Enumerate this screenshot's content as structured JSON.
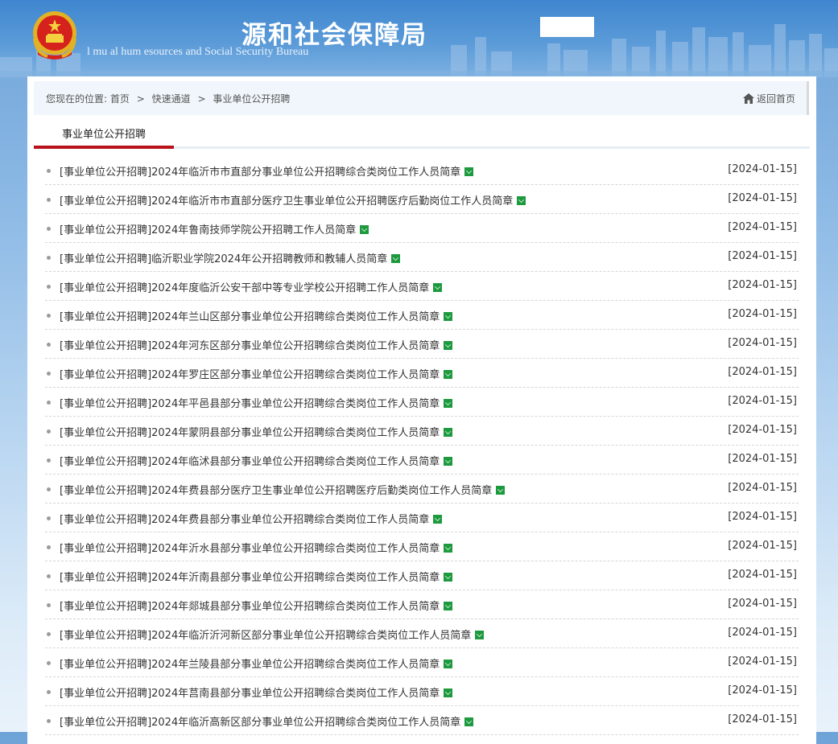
{
  "header": {
    "title_cn": "源和社会保障局",
    "title_en": "l    mu    al hum    esources and Social Security Bureau",
    "emblem_icon": "national-emblem-icon"
  },
  "breadcrumb": {
    "prefix": "您现在的位置:",
    "items": [
      "首页",
      "快速通道",
      "事业单位公开招聘"
    ],
    "separator": ">"
  },
  "home_link": {
    "label": "返回首页",
    "icon": "home-icon"
  },
  "tab": {
    "label": "事业单位公开招聘"
  },
  "colors": {
    "accent_red": "#b9121b",
    "new_badge": "#1d9a3e",
    "banner_blue": "#3f86cf"
  },
  "articles": [
    {
      "title": "[事业单位公开招聘]2024年临沂市市直部分事业单位公开招聘综合类岗位工作人员简章",
      "date": "[2024-01-15]"
    },
    {
      "title": "[事业单位公开招聘]2024年临沂市市直部分医疗卫生事业单位公开招聘医疗后勤岗位工作人员简章",
      "date": "[2024-01-15]"
    },
    {
      "title": "[事业单位公开招聘]2024年鲁南技师学院公开招聘工作人员简章",
      "date": "[2024-01-15]"
    },
    {
      "title": "[事业单位公开招聘]临沂职业学院2024年公开招聘教师和教辅人员简章",
      "date": "[2024-01-15]"
    },
    {
      "title": "[事业单位公开招聘]2024年度临沂公安干部中等专业学校公开招聘工作人员简章",
      "date": "[2024-01-15]"
    },
    {
      "title": "[事业单位公开招聘]2024年兰山区部分事业单位公开招聘综合类岗位工作人员简章",
      "date": "[2024-01-15]"
    },
    {
      "title": "[事业单位公开招聘]2024年河东区部分事业单位公开招聘综合类岗位工作人员简章",
      "date": "[2024-01-15]"
    },
    {
      "title": "[事业单位公开招聘]2024年罗庄区部分事业单位公开招聘综合类岗位工作人员简章",
      "date": "[2024-01-15]"
    },
    {
      "title": "[事业单位公开招聘]2024年平邑县部分事业单位公开招聘综合类岗位工作人员简章",
      "date": "[2024-01-15]"
    },
    {
      "title": "[事业单位公开招聘]2024年蒙阴县部分事业单位公开招聘综合类岗位工作人员简章",
      "date": "[2024-01-15]"
    },
    {
      "title": "[事业单位公开招聘]2024年临沭县部分事业单位公开招聘综合类岗位工作人员简章",
      "date": "[2024-01-15]"
    },
    {
      "title": "[事业单位公开招聘]2024年费县部分医疗卫生事业单位公开招聘医疗后勤类岗位工作人员简章",
      "date": "[2024-01-15]"
    },
    {
      "title": "[事业单位公开招聘]2024年费县部分事业单位公开招聘综合类岗位工作人员简章",
      "date": "[2024-01-15]"
    },
    {
      "title": "[事业单位公开招聘]2024年沂水县部分事业单位公开招聘综合类岗位工作人员简章",
      "date": "[2024-01-15]"
    },
    {
      "title": "[事业单位公开招聘]2024年沂南县部分事业单位公开招聘综合类岗位工作人员简章",
      "date": "[2024-01-15]"
    },
    {
      "title": "[事业单位公开招聘]2024年郯城县部分事业单位公开招聘综合类岗位工作人员简章",
      "date": "[2024-01-15]"
    },
    {
      "title": "[事业单位公开招聘]2024年临沂沂河新区部分事业单位公开招聘综合类岗位工作人员简章",
      "date": "[2024-01-15]"
    },
    {
      "title": "[事业单位公开招聘]2024年兰陵县部分事业单位公开招聘综合类岗位工作人员简章",
      "date": "[2024-01-15]"
    },
    {
      "title": "[事业单位公开招聘]2024年莒南县部分事业单位公开招聘综合类岗位工作人员简章",
      "date": "[2024-01-15]"
    },
    {
      "title": "[事业单位公开招聘]2024年临沂高新区部分事业单位公开招聘综合类岗位工作人员简章",
      "date": "[2024-01-15]"
    }
  ]
}
